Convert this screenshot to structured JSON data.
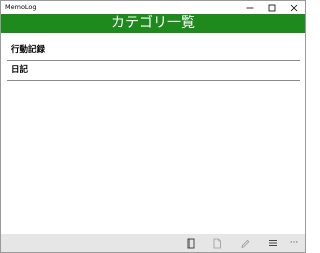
{
  "window": {
    "app_title": "MemoLog"
  },
  "header": {
    "title": "カテゴリ一覧",
    "color": "#1e8a1e"
  },
  "categories": [
    {
      "label": "行動記録"
    },
    {
      "label": "日記"
    }
  ],
  "appbar": {
    "icons": [
      "book-icon",
      "page-icon",
      "edit-pencil-icon",
      "list-icon",
      "more-ellipsis-icon"
    ],
    "more_label": "···"
  },
  "caption_buttons": [
    "minimize-icon",
    "maximize-icon",
    "close-icon"
  ]
}
